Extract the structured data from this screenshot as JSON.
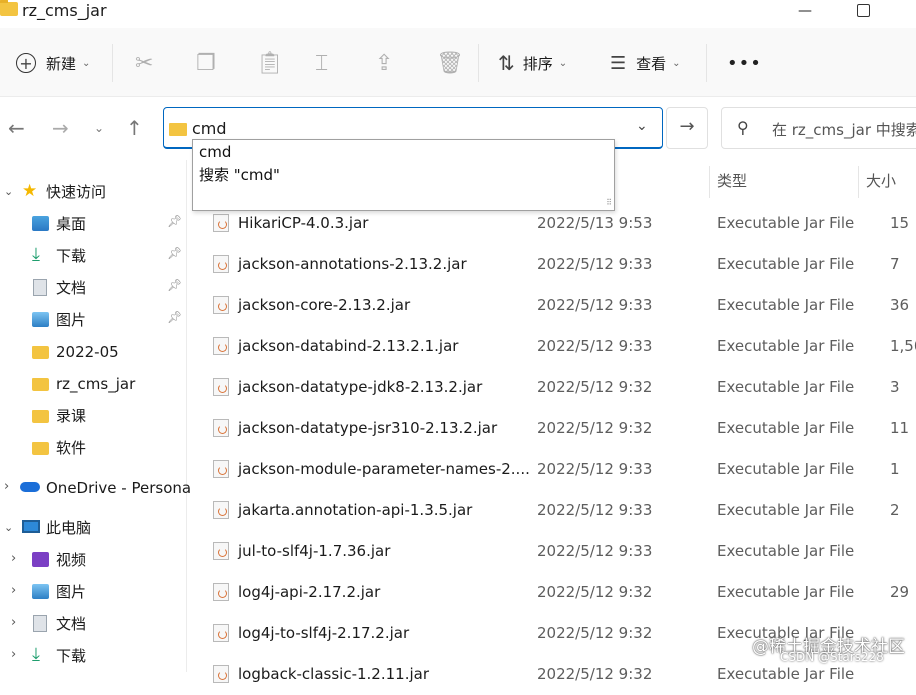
{
  "window": {
    "title": "rz_cms_jar",
    "minimize": "—",
    "maximize": ""
  },
  "toolbar": {
    "new_label": "新建",
    "sort_label": "排序",
    "view_label": "查看",
    "more_label": "•••"
  },
  "address": {
    "value": "cmd",
    "search_placeholder": "在 rz_cms_jar 中搜索"
  },
  "dropdown": {
    "items": [
      "cmd",
      "搜索 \"cmd\""
    ]
  },
  "sidebar": {
    "quick_access": "快速访问",
    "items": [
      {
        "label": "桌面",
        "icon": "desktop-icon"
      },
      {
        "label": "下载",
        "icon": "download-icon"
      },
      {
        "label": "文档",
        "icon": "document-icon"
      },
      {
        "label": "图片",
        "icon": "pictures-icon"
      },
      {
        "label": "2022-05",
        "icon": "folder-icon"
      },
      {
        "label": "rz_cms_jar",
        "icon": "folder-icon"
      },
      {
        "label": "录课",
        "icon": "folder-icon"
      },
      {
        "label": "软件",
        "icon": "folder-icon"
      }
    ],
    "onedrive": "OneDrive - Persona",
    "this_pc": "此电脑",
    "pc_items": [
      {
        "label": "视频",
        "icon": "video-icon"
      },
      {
        "label": "图片",
        "icon": "pictures-icon"
      },
      {
        "label": "文档",
        "icon": "document-icon"
      },
      {
        "label": "下载",
        "icon": "download-icon"
      }
    ]
  },
  "columns": {
    "type": "类型",
    "size": "大小"
  },
  "files": [
    {
      "name": "HikariCP-4.0.3.jar",
      "date": "2022/5/13 9:53",
      "type": "Executable Jar File",
      "size": "15"
    },
    {
      "name": "jackson-annotations-2.13.2.jar",
      "date": "2022/5/12 9:33",
      "type": "Executable Jar File",
      "size": "7"
    },
    {
      "name": "jackson-core-2.13.2.jar",
      "date": "2022/5/12 9:33",
      "type": "Executable Jar File",
      "size": "36"
    },
    {
      "name": "jackson-databind-2.13.2.1.jar",
      "date": "2022/5/12 9:33",
      "type": "Executable Jar File",
      "size": "1,50"
    },
    {
      "name": "jackson-datatype-jdk8-2.13.2.jar",
      "date": "2022/5/12 9:32",
      "type": "Executable Jar File",
      "size": "3"
    },
    {
      "name": "jackson-datatype-jsr310-2.13.2.jar",
      "date": "2022/5/12 9:32",
      "type": "Executable Jar File",
      "size": "11"
    },
    {
      "name": "jackson-module-parameter-names-2....",
      "date": "2022/5/12 9:33",
      "type": "Executable Jar File",
      "size": "1"
    },
    {
      "name": "jakarta.annotation-api-1.3.5.jar",
      "date": "2022/5/12 9:33",
      "type": "Executable Jar File",
      "size": "2"
    },
    {
      "name": "jul-to-slf4j-1.7.36.jar",
      "date": "2022/5/12 9:33",
      "type": "Executable Jar File",
      "size": ""
    },
    {
      "name": "log4j-api-2.17.2.jar",
      "date": "2022/5/12 9:32",
      "type": "Executable Jar File",
      "size": "29"
    },
    {
      "name": "log4j-to-slf4j-2.17.2.jar",
      "date": "2022/5/12 9:32",
      "type": "Executable Jar File",
      "size": ""
    },
    {
      "name": "logback-classic-1.2.11.jar",
      "date": "2022/5/12 9:32",
      "type": "Executable Jar File",
      "size": ""
    }
  ],
  "watermark": {
    "line1": "@稀土掘金技术社区",
    "line2": "CSDN @Stars228"
  }
}
